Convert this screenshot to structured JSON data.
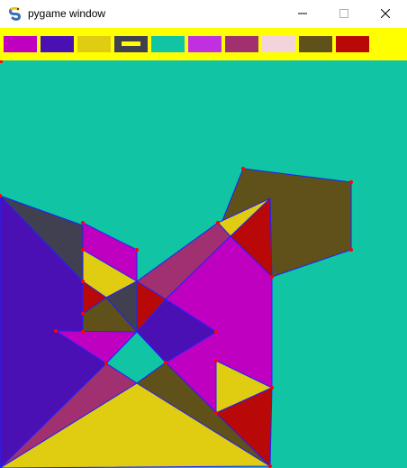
{
  "window": {
    "title": "pygame window",
    "app_icon": "pygame-snake-icon",
    "controls": {
      "minimize_icon": "minimize-icon",
      "maximize_icon": "maximize-icon",
      "close_icon": "close-icon"
    }
  },
  "toolbar": {
    "background": "#ffff00",
    "swatches": [
      {
        "name": "swatch-magenta",
        "color": "#c000c0",
        "selected": false
      },
      {
        "name": "swatch-indigo",
        "color": "#4b10b4",
        "selected": false
      },
      {
        "name": "swatch-yellow",
        "color": "#e0cc10",
        "selected": false
      },
      {
        "name": "swatch-dark-slate",
        "color": "#404050",
        "selected": true
      },
      {
        "name": "swatch-teal",
        "color": "#10c4a4",
        "selected": false
      },
      {
        "name": "swatch-violet",
        "color": "#c030e0",
        "selected": false
      },
      {
        "name": "swatch-plum",
        "color": "#a03070",
        "selected": false
      },
      {
        "name": "swatch-pink",
        "color": "#f4d4dc",
        "selected": false
      },
      {
        "name": "swatch-olive",
        "color": "#60501a",
        "selected": false
      },
      {
        "name": "swatch-red",
        "color": "#b80808",
        "selected": false
      }
    ]
  },
  "canvas": {
    "background": "#10c4a4",
    "edge_color": "#2020ff",
    "vertex_color": "#ff0000"
  }
}
